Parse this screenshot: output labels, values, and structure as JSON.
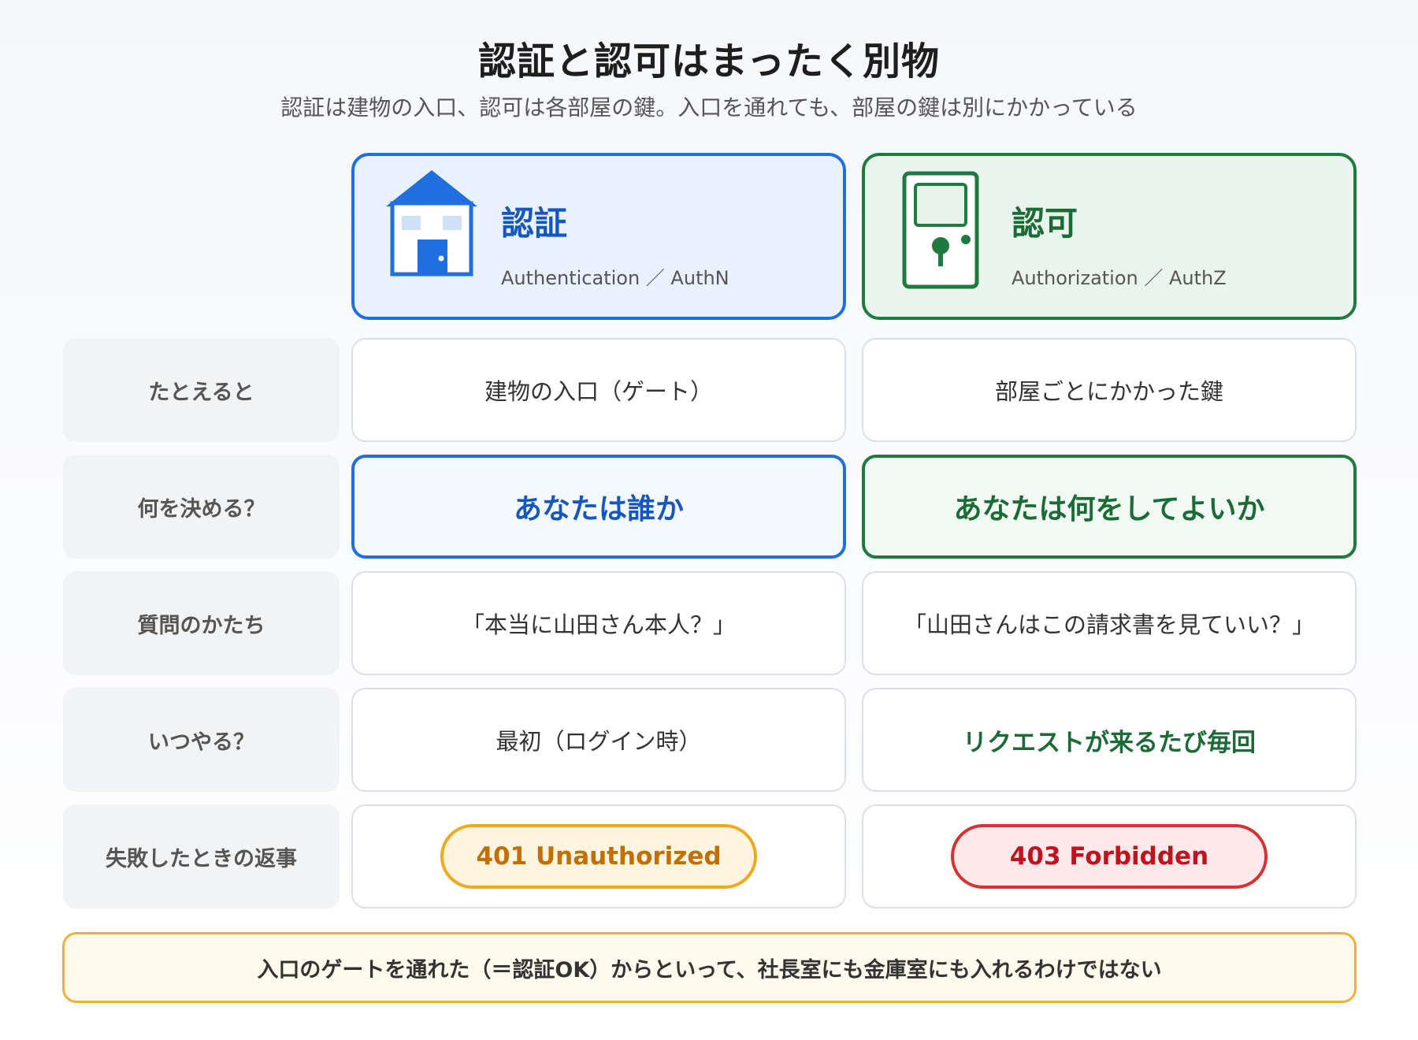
{
  "title": "認証と認可はまったく別物",
  "subtitle": "認証は建物の入口、認可は各部屋の鍵。入口を通れても、部屋の鍵は別にかかっている",
  "columns": {
    "authn": {
      "name": "認証",
      "sub": "Authentication ／ AuthN",
      "icon": "house-icon",
      "color": "#1f6fe0"
    },
    "authz": {
      "name": "認可",
      "sub": "Authorization ／ AuthZ",
      "icon": "door-icon",
      "color": "#1e7a3f"
    }
  },
  "rows": [
    {
      "label": "たとえると",
      "authn": "建物の入口（ゲート）",
      "authz": "部屋ごとにかかった鍵"
    },
    {
      "label": "何を決める？",
      "authn": "あなたは誰か",
      "authz": "あなたは何をしてよいか"
    },
    {
      "label": "質問のかたち",
      "authn": "「本当に山田さん本人？」",
      "authz": "「山田さんはこの請求書を見ていい？」"
    },
    {
      "label": "いつやる？",
      "authn": "最初（ログイン時）",
      "authz": "リクエストが来るたび毎回"
    },
    {
      "label": "失敗したときの返事",
      "authn": "401 Unauthorized",
      "authz": "403 Forbidden"
    }
  ],
  "status_colors": {
    "unauthorized": "#f0a81d",
    "forbidden": "#d93030"
  },
  "footer": "入口のゲートを通れた（＝認証OK）からといって、社長室にも金庫室にも入れるわけではない"
}
